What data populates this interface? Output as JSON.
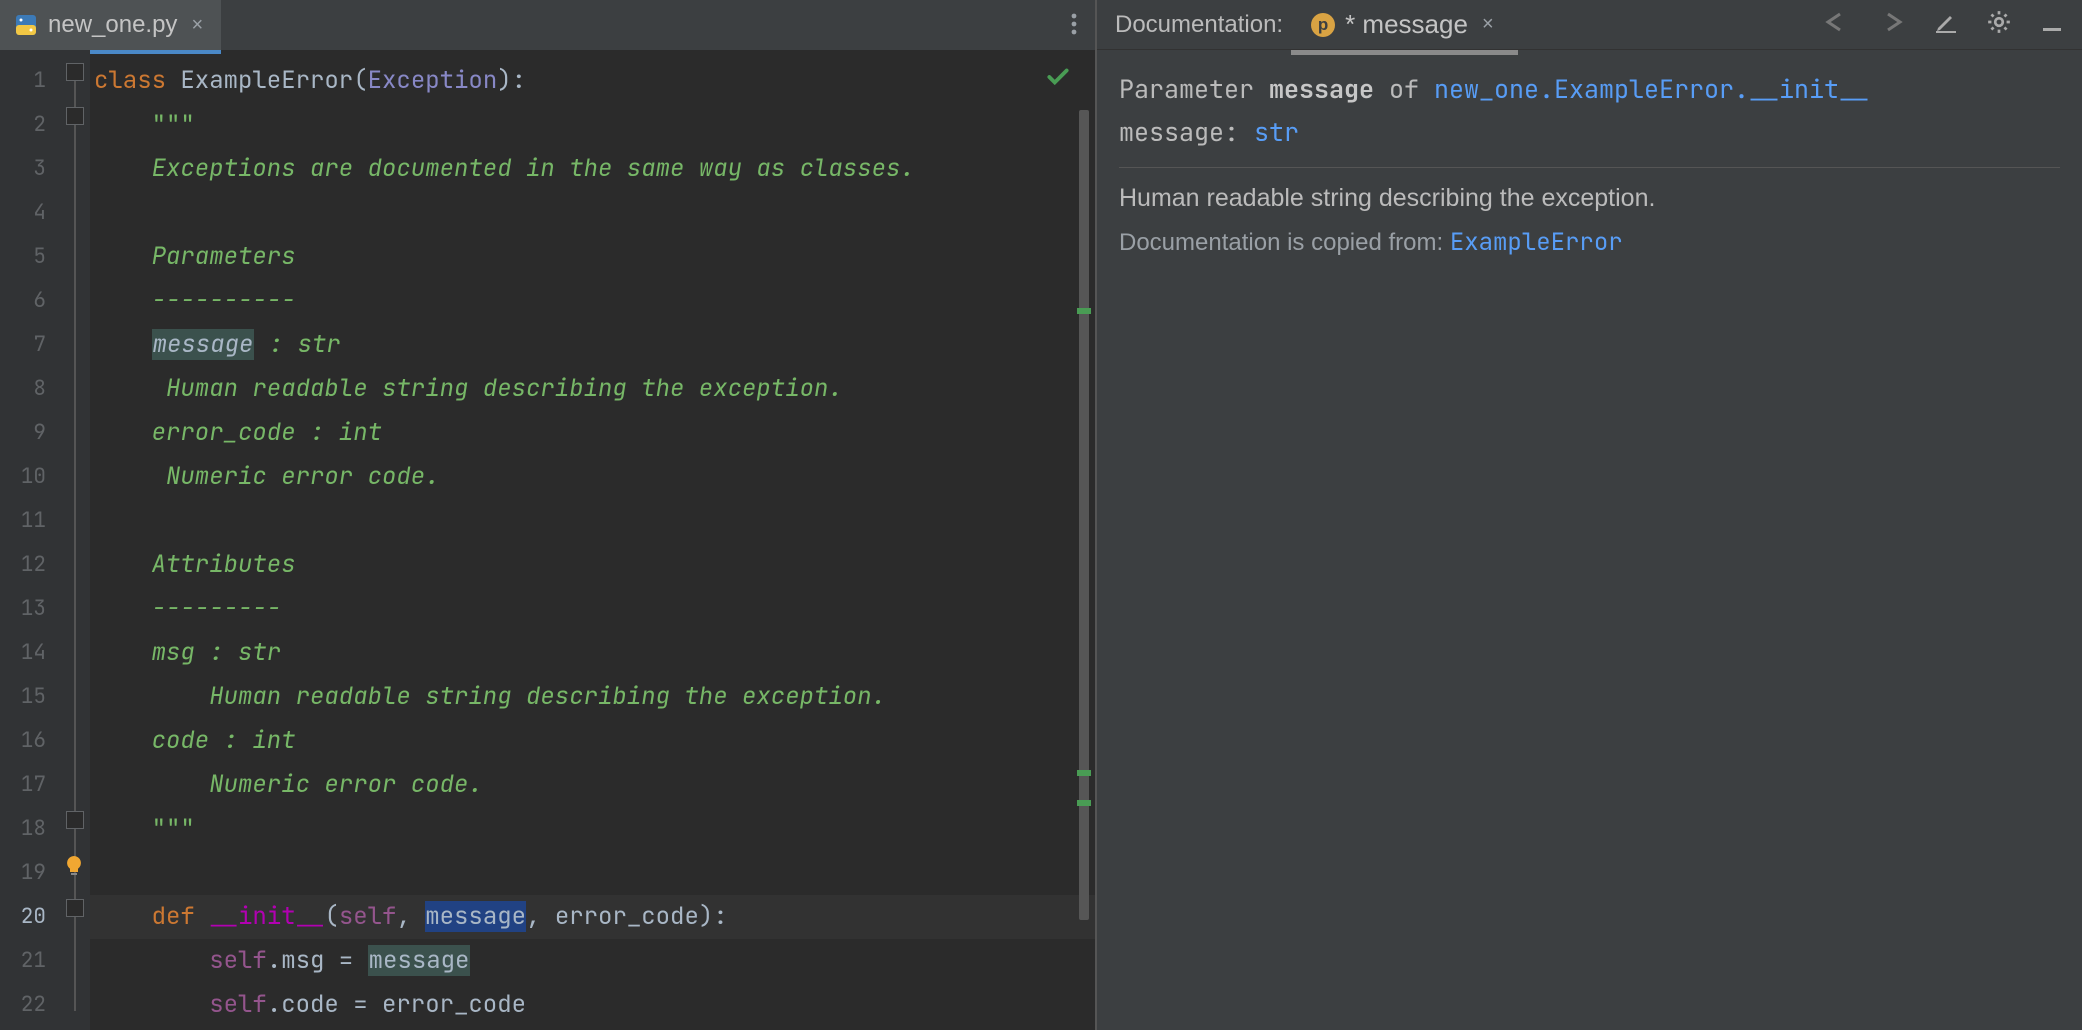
{
  "editor": {
    "tab": {
      "filename": "new_one.py"
    },
    "line_numbers": [
      "1",
      "2",
      "3",
      "4",
      "5",
      "6",
      "7",
      "8",
      "9",
      "10",
      "11",
      "12",
      "13",
      "14",
      "15",
      "16",
      "17",
      "18",
      "19",
      "20",
      "21",
      "22"
    ],
    "current_line": 20,
    "code": {
      "l1_class": "class ",
      "l1_name": "ExampleError",
      "l1_paren_open": "(",
      "l1_exception": "Exception",
      "l1_paren_close": "):",
      "l2_q": "    \"\"\"",
      "l3": "    Exceptions are documented in the same way as classes.",
      "l4": "",
      "l5": "    Parameters",
      "l6": "    ----------",
      "l7_pre": "    ",
      "l7_msg": "message",
      "l7_post": " : str",
      "l8": "     Human readable string describing the exception.",
      "l9": "    error_code : int",
      "l10": "     Numeric error code.",
      "l11": "",
      "l12": "    Attributes",
      "l13": "    ---------",
      "l14": "    msg : str",
      "l15": "        Human readable string describing the exception.",
      "l16": "    code : int",
      "l17": "        Numeric error code.",
      "l18_q": "    \"\"\"",
      "l19": "",
      "l20_def": "    def ",
      "l20_fn": "__init__",
      "l20_po": "(",
      "l20_self": "self",
      "l20_c1": ", ",
      "l20_msg": "message",
      "l20_c2": ", ",
      "l20_err": "error_code",
      "l20_pc": "):",
      "l21_self": "        self",
      "l21_dot": ".msg = ",
      "l21_msg": "message",
      "l22_self": "        self",
      "l22_rest": ".code = error_code"
    }
  },
  "doc": {
    "header_title": "Documentation:",
    "tab_label": "* message",
    "sig_pre": "Parameter ",
    "sig_param": "message",
    "sig_of": " of ",
    "sig_link": "new_one.ExampleError.__init__",
    "sig_line2_name": "message: ",
    "sig_line2_type": "str",
    "description": "Human readable string describing the exception.",
    "copied_label": "Documentation is copied from: ",
    "copied_link": "ExampleError"
  }
}
